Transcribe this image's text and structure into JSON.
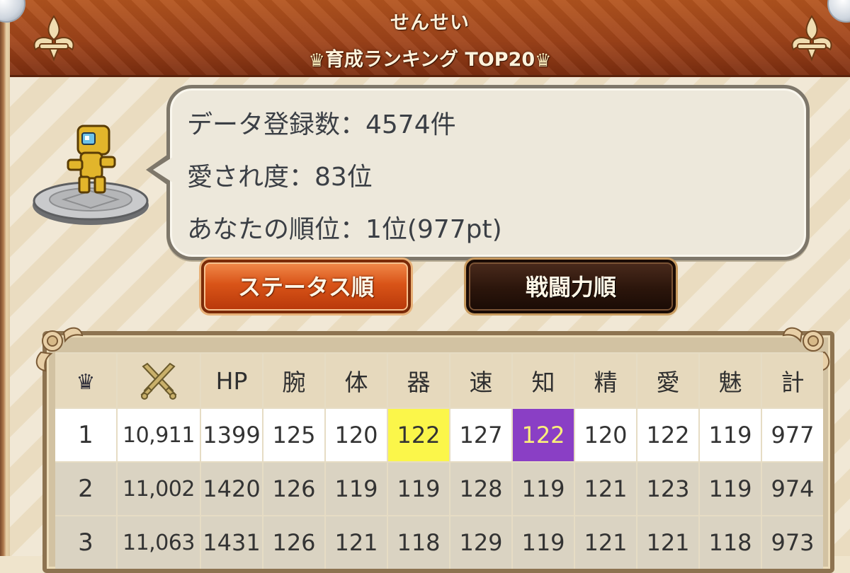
{
  "header": {
    "title": "せんせい",
    "subtitle": "育成ランキング TOP20"
  },
  "info": {
    "line1": "データ登録数：4574件",
    "line2": "愛され度：83位",
    "line3": "あなたの順位：1位(977pt)"
  },
  "buttons": {
    "status_label": "ステータス順",
    "power_label": "戦闘力順"
  },
  "table": {
    "headers": [
      "HP",
      "腕",
      "体",
      "器",
      "速",
      "知",
      "精",
      "愛",
      "魅",
      "計"
    ],
    "rows": [
      {
        "rank": "1",
        "power": "10,911",
        "stats": [
          "1399",
          "125",
          "120",
          "122",
          "127",
          "122",
          "120",
          "122",
          "119",
          "977"
        ]
      },
      {
        "rank": "2",
        "power": "11,002",
        "stats": [
          "1420",
          "126",
          "119",
          "119",
          "128",
          "119",
          "121",
          "123",
          "119",
          "974"
        ]
      },
      {
        "rank": "3",
        "power": "11,063",
        "stats": [
          "1431",
          "126",
          "121",
          "118",
          "129",
          "119",
          "121",
          "121",
          "118",
          "973"
        ]
      }
    ]
  },
  "colors": {
    "header_brown": "#a0441a",
    "highlight_yellow": "#fbf64a",
    "highlight_purple": "#8a3fc5"
  }
}
